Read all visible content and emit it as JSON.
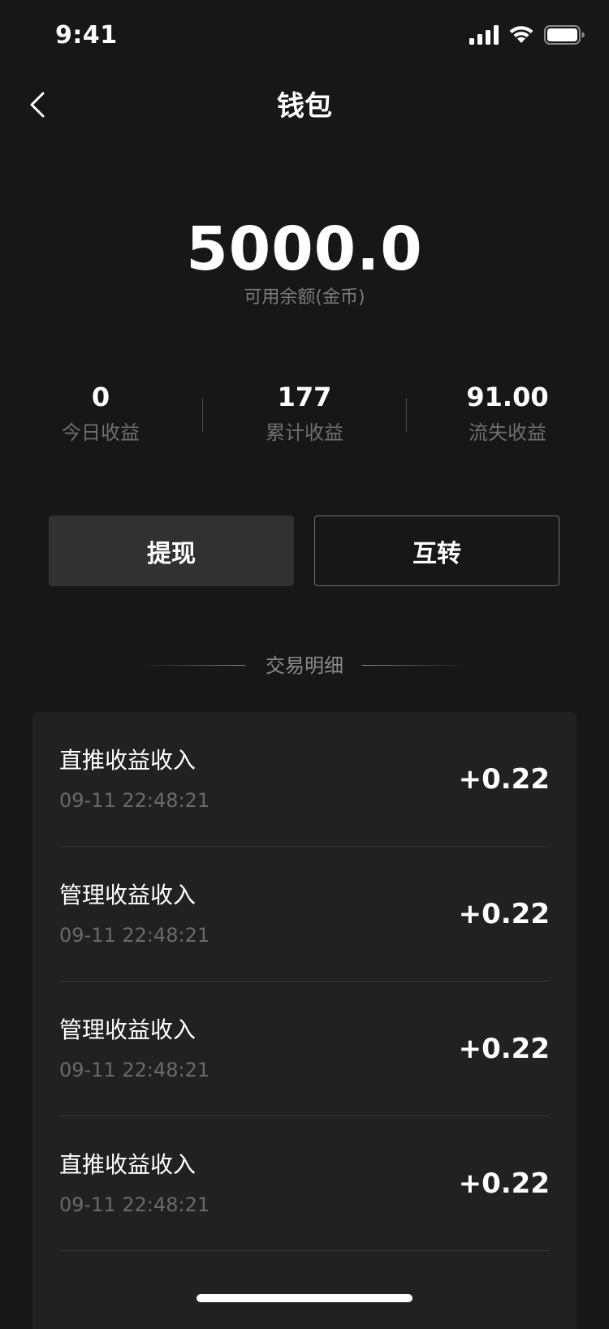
{
  "status_bar": {
    "time": "9:41",
    "icons": [
      "cellular-signal-icon",
      "wifi-icon",
      "battery-icon"
    ]
  },
  "nav": {
    "back_icon": "chevron-left-icon",
    "title": "钱包"
  },
  "balance": {
    "value": "5000.0",
    "label": "可用余额(金币)"
  },
  "stats": [
    {
      "value": "0",
      "label": "今日收益"
    },
    {
      "value": "177",
      "label": "累计收益"
    },
    {
      "value": "91.00",
      "label": "流失收益"
    }
  ],
  "actions": {
    "withdraw_label": "提现",
    "transfer_label": "互转"
  },
  "transactions": {
    "section_title": "交易明细",
    "items": [
      {
        "title": "直推收益收入",
        "time": "09-11 22:48:21",
        "amount": "+0.22"
      },
      {
        "title": "管理收益收入",
        "time": "09-11 22:48:21",
        "amount": "+0.22"
      },
      {
        "title": "管理收益收入",
        "time": "09-11 22:48:21",
        "amount": "+0.22"
      },
      {
        "title": "直推收益收入",
        "time": "09-11 22:48:21",
        "amount": "+0.22"
      }
    ]
  },
  "colors": {
    "background": "#171717",
    "card": "#212121",
    "button_primary_bg": "#323132",
    "muted_text": "#6e6e6e",
    "text": "#ffffff"
  }
}
